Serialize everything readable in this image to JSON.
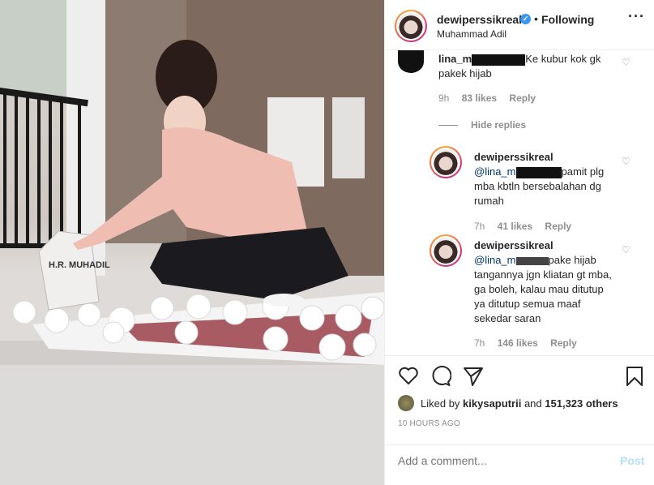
{
  "header": {
    "username": "dewiperssikreal",
    "separator": "•",
    "follow_status": "Following",
    "location": "Muhammad Adil",
    "more": "···"
  },
  "comments": [
    {
      "username": "lina_m",
      "text": "Ke kubur kok gk pakek hijab",
      "time": "9h",
      "likes": "83 likes",
      "reply": "Reply"
    }
  ],
  "hide_replies": "Hide replies",
  "replies": [
    {
      "username": "dewiperssikreal",
      "mention": "@lina_m",
      "text_after": "pamit plg mba kbtln bersebalahan dg rumah",
      "time": "7h",
      "likes": "41 likes",
      "reply": "Reply"
    },
    {
      "username": "dewiperssikreal",
      "mention": "@lina_m",
      "text_after": "pake hijab tangannya jgn kliatan gt mba, ga boleh, kalau mau ditutup ya ditutup semua maaf sekedar saran",
      "time": "7h",
      "likes": "146 likes",
      "reply": "Reply"
    }
  ],
  "likes": {
    "prefix": "Liked by",
    "user": "kikysaputrii",
    "middle": "and",
    "count": "151,323 others"
  },
  "time_ago": "10 HOURS AGO",
  "add_comment": {
    "placeholder": "Add a comment...",
    "post": "Post"
  },
  "photo": {
    "headstone_text": "H.R. MUHADIL"
  },
  "colors": {
    "verified": "#3897f0",
    "post_disabled": "#b2dffc",
    "muted": "#8e8e8e"
  }
}
